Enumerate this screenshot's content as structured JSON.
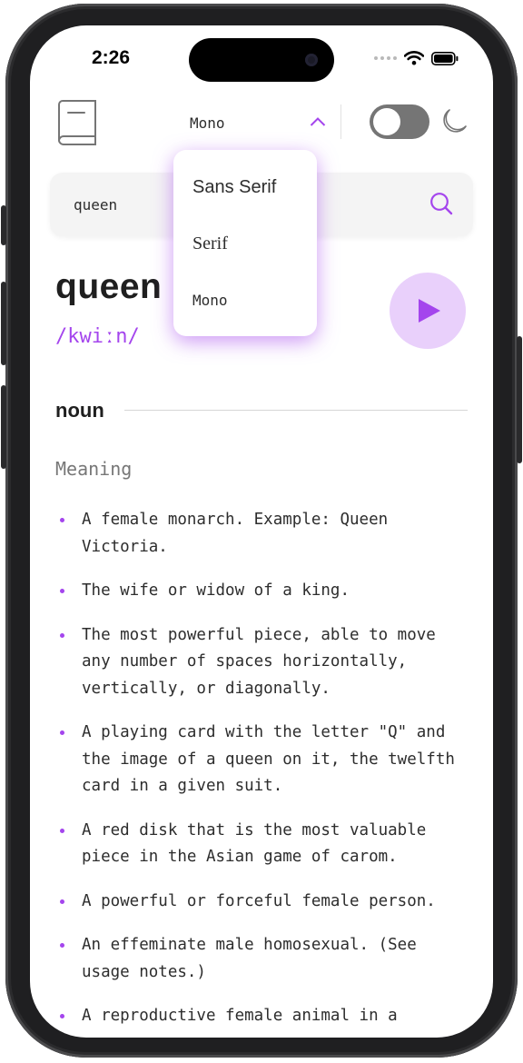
{
  "status_bar": {
    "time": "2:26"
  },
  "header": {
    "font_select": {
      "label": "Mono"
    },
    "theme_toggle": {
      "state": "off"
    }
  },
  "font_menu": {
    "options": [
      "Sans Serif",
      "Serif",
      "Mono"
    ]
  },
  "search": {
    "value": "queen"
  },
  "entry": {
    "word": "queen",
    "phonetic": "/kwiːn/",
    "part_of_speech": "noun",
    "meaning_heading": "Meaning",
    "definitions": [
      "A female monarch. Example: Queen Victoria.",
      "The wife or widow of a king.",
      "The most powerful piece, able to move any number of spaces horizontally, vertically, or diagonally.",
      "A playing card with the letter \"Q\" and the image of a queen on it, the twelfth card in a given suit.",
      "A red disk that is the most valuable piece in the Asian game of carom.",
      "A powerful or forceful female person.",
      "An effeminate male homosexual. (See usage notes.)",
      "A reproductive female animal in a"
    ]
  },
  "colors": {
    "accent": "#a445ed",
    "play_button_bg": "#e9d0fb",
    "toggle_off": "#757575"
  }
}
